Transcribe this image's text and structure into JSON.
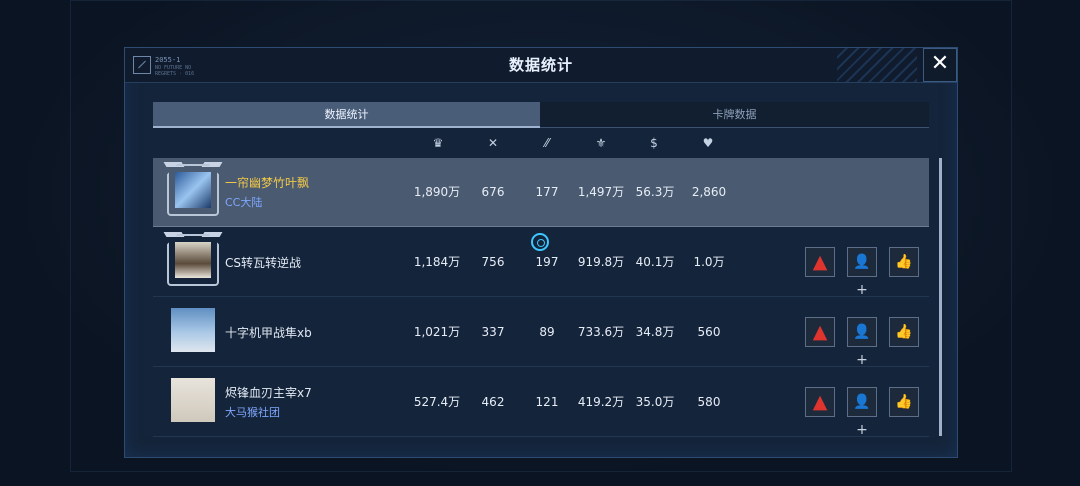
{
  "dialog": {
    "title": "数据统计",
    "logo_text": "2055-1",
    "logo_sub": "NO FUTURE NO REGRETS · 016",
    "close_label": "✕"
  },
  "tabs": [
    {
      "label": "数据统计",
      "active": true
    },
    {
      "label": "卡牌数据",
      "active": false
    }
  ],
  "column_icons": [
    "rank-icon",
    "swords-icon",
    "slash-icon",
    "shield-icon",
    "dollar-icon",
    "heart-icon"
  ],
  "column_glyphs": [
    "♛",
    "✕",
    "⁄⁄",
    "⚜",
    "$",
    "♥"
  ],
  "players": [
    {
      "name": "一帘幽梦竹叶飘",
      "club": "CC大陆",
      "highlight": true,
      "stats": [
        "1,890万",
        "676",
        "177",
        "1,497万",
        "56.3万",
        "2,860"
      ],
      "actions": false
    },
    {
      "name": "CS转瓦转逆战",
      "club": "",
      "highlight": false,
      "stats": [
        "1,184万",
        "756",
        "197",
        "919.8万",
        "40.1万",
        "1.0万"
      ],
      "actions": true
    },
    {
      "name": "十字机甲战隼xb",
      "club": "",
      "highlight": false,
      "stats": [
        "1,021万",
        "337",
        "89",
        "733.6万",
        "34.8万",
        "560"
      ],
      "actions": true
    },
    {
      "name": "烬锋血刃主宰x7",
      "club": "大马猴社团",
      "highlight": false,
      "stats": [
        "527.4万",
        "462",
        "121",
        "419.2万",
        "35.0万",
        "580"
      ],
      "actions": true
    }
  ],
  "action_glyphs": {
    "report": "▲",
    "add_friend": "👤+",
    "like": "👍"
  },
  "colors": {
    "accent": "#3cc7ff",
    "highlight_name": "#f0c84a",
    "club": "#7fa7ff",
    "warn": "#e0342f"
  }
}
